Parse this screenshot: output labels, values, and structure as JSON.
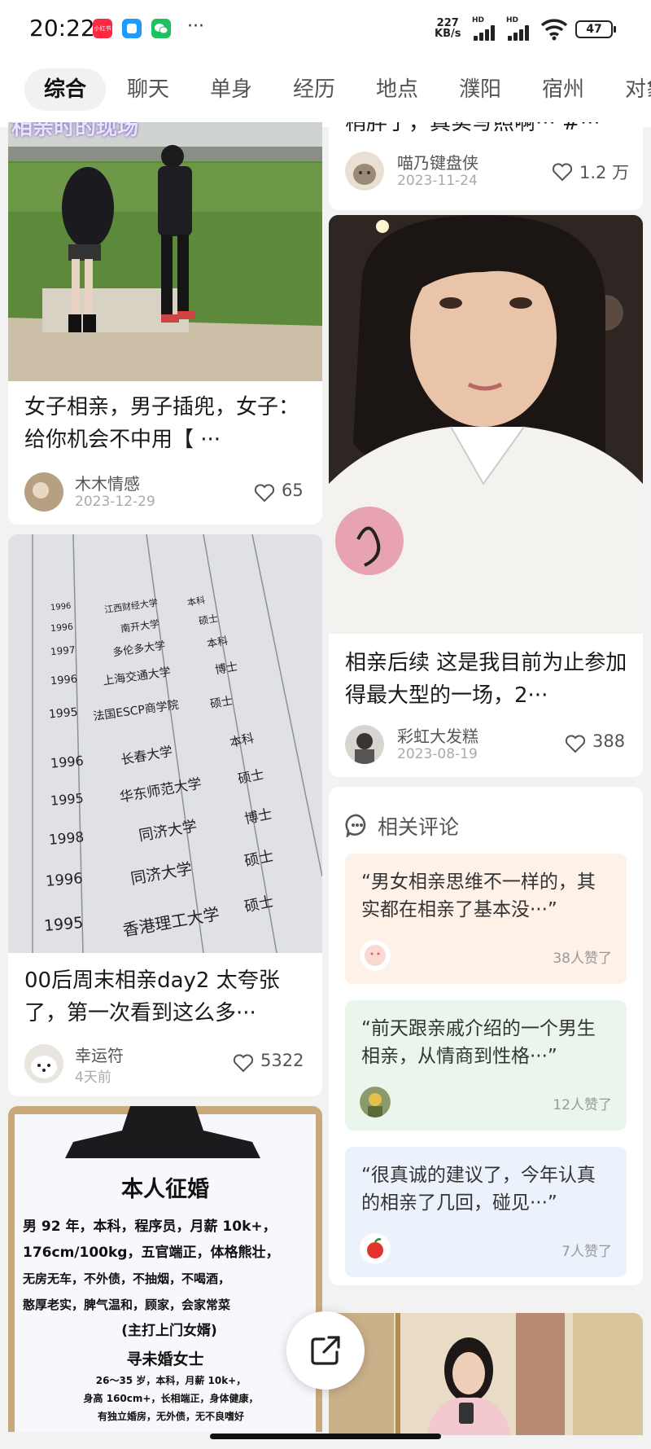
{
  "status_bar": {
    "time": "20:22",
    "app_red_label": "小红书",
    "more": "···",
    "net_speed_value": "227",
    "net_speed_unit": "KB/s",
    "signal1_label": "HD",
    "signal2_label": "HD",
    "battery": "47",
    "icons": [
      "xiaohongshu-app-icon",
      "message-app-icon",
      "wechat-icon",
      "signal-icon",
      "wifi-icon",
      "battery-icon"
    ]
  },
  "tabs": [
    {
      "label": "综合",
      "active": true
    },
    {
      "label": "聊天"
    },
    {
      "label": "单身"
    },
    {
      "label": "经历"
    },
    {
      "label": "地点"
    },
    {
      "label": "濮阳"
    },
    {
      "label": "宿州"
    },
    {
      "label": "对象"
    }
  ],
  "left_column": [
    {
      "overlay_text": "相亲时的现场",
      "title": "女子相亲，男子插兜，女子：给你机会不中用【 ···",
      "author": "木木情感",
      "date": "2023-12-29",
      "likes": "65"
    },
    {
      "title": "00后周末相亲day2 太夸张了，第一次看到这么多···",
      "author": "幸运符",
      "date": "4天前",
      "likes": "5322",
      "table_rows": [
        [
          "1995",
          "香港理工大学",
          "硕士"
        ],
        [
          "1996",
          "同济大学",
          "硕士"
        ],
        [
          "1998",
          "同济大学",
          "博士"
        ],
        [
          "1995",
          "华东师范大学",
          "硕士"
        ],
        [
          "1996",
          "长春大学",
          "本科"
        ],
        [
          "1995",
          "法国ESCP商学院",
          "硕士"
        ],
        [
          "1996",
          "上海交通大学",
          "博士"
        ],
        [
          "1997",
          "多伦多大学",
          "本科"
        ],
        [
          "1996",
          "南开大学",
          "硕士"
        ],
        [
          "1996",
          "江西财经大学",
          "本科"
        ]
      ]
    },
    {
      "poster_title": "本人征婚",
      "poster_lines": [
        "男 92 年，本科，程序员，月薪 10k+，",
        "176cm/100kg，五官端正，体格熊壮，",
        "无房无车，不外债，不抽烟，不喝酒，",
        "憨厚老实，脾气温和，顾家，会家常菜",
        "(主打上门女婿)"
      ],
      "poster_sub": "寻未婚女士",
      "poster_lines2": [
        "26～35 岁，本科，月薪 10k+，",
        "身高 160cm+，长相端正，身体健康，",
        "有独立婚房，无外债，无不良嗜好"
      ]
    }
  ],
  "right_column": [
    {
      "title_partial": "稍胖了，真实写照啊··· #···",
      "author": "喵乃键盘侠",
      "date": "2023-11-24",
      "likes": "1.2 万"
    },
    {
      "title": "相亲后续 这是我目前为止参加得最大型的一场，2···",
      "author": "彩虹大发糕",
      "date": "2023-08-19",
      "likes": "388"
    }
  ],
  "comments_section": {
    "title": "相关评论",
    "items": [
      {
        "text": "“男女相亲思维不一样的，其实都在相亲了基本没···”",
        "likes": "38人赞了",
        "bg": "#fdf1e8"
      },
      {
        "text": "“前天跟亲戚介绍的一个男生相亲，从情商到性格···”",
        "likes": "12人赞了",
        "bg": "#eaf5ec"
      },
      {
        "text": "“很真诚的建议了，今年认真的相亲了几回，碰见···”",
        "likes": "7人赞了",
        "bg": "#ecf2fb"
      }
    ]
  },
  "colors": {
    "accent": "#ff2741",
    "background": "#f2f2f2"
  }
}
